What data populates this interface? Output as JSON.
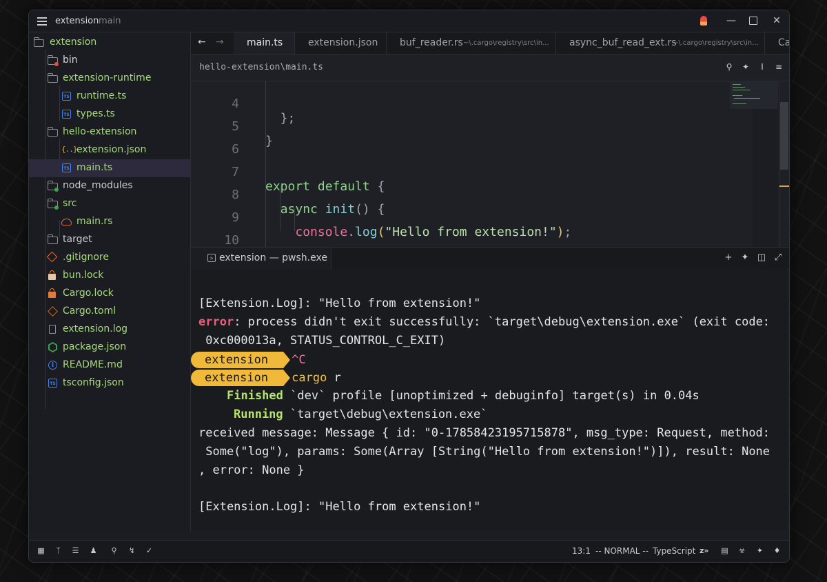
{
  "titlebar": {
    "project": "extension",
    "branch": "main"
  },
  "sidebar": {
    "items": [
      {
        "label": "extension",
        "icon": "folder-icon",
        "color": "#a6d97b"
      },
      {
        "label": "bin",
        "icon": "folder-icon",
        "color": "#d4d6dc"
      },
      {
        "label": "extension-runtime",
        "icon": "folder-icon",
        "color": "#a6d97b"
      },
      {
        "label": "runtime.ts",
        "icon": "typescript-icon",
        "color": "#a6d97b"
      },
      {
        "label": "types.ts",
        "icon": "typescript-icon",
        "color": "#a6d97b"
      },
      {
        "label": "hello-extension",
        "icon": "folder-icon",
        "color": "#a6d97b"
      },
      {
        "label": "extension.json",
        "icon": "json-icon",
        "color": "#a6d97b"
      },
      {
        "label": "main.ts",
        "icon": "typescript-icon",
        "color": "#a6d97b"
      },
      {
        "label": "node_modules",
        "icon": "folder-icon",
        "color": "#c8cbd2"
      },
      {
        "label": "src",
        "icon": "folder-icon",
        "color": "#a6d97b"
      },
      {
        "label": "main.rs",
        "icon": "rust-icon",
        "color": "#a6d97b"
      },
      {
        "label": "target",
        "icon": "folder-icon",
        "color": "#c8cbd2"
      },
      {
        "label": ".gitignore",
        "icon": "git-icon",
        "color": "#a6d97b"
      },
      {
        "label": "bun.lock",
        "icon": "lock-icon",
        "color": "#a6d97b"
      },
      {
        "label": "Cargo.lock",
        "icon": "lock-icon",
        "color": "#a6d97b"
      },
      {
        "label": "Cargo.toml",
        "icon": "cargo-icon",
        "color": "#a6d97b"
      },
      {
        "label": "extension.log",
        "icon": "file-icon",
        "color": "#a6d97b"
      },
      {
        "label": "package.json",
        "icon": "nodejs-icon",
        "color": "#a6d97b"
      },
      {
        "label": "README.md",
        "icon": "info-icon",
        "color": "#a6d97b"
      },
      {
        "label": "tsconfig.json",
        "icon": "tsconfig-icon",
        "color": "#a6d97b"
      }
    ]
  },
  "tabs": [
    {
      "title": "main.ts",
      "path": ""
    },
    {
      "title": "extension.json",
      "path": ""
    },
    {
      "title": "buf_reader.rs",
      "path": "~\\.cargo\\registry\\src\\in..."
    },
    {
      "title": "async_buf_read_ext.rs",
      "path": "~\\.cargo\\registry\\src\\in..."
    },
    {
      "title": "Ca",
      "path": ""
    }
  ],
  "breadcrumb": "hello-extension\\main.ts",
  "code": {
    "lines": [
      {
        "n": "4",
        "text": "  };"
      },
      {
        "n": "5",
        "text": "}"
      },
      {
        "n": "6",
        "text": ""
      },
      {
        "n": "7",
        "text": "export default {"
      },
      {
        "n": "8",
        "text": "  async init() {"
      },
      {
        "n": "9",
        "text": "    console.log(\"Hello from extension!\");"
      },
      {
        "n": "10",
        "text": "  },"
      }
    ]
  },
  "terminal": {
    "tab_title": "extension — pwsh.exe",
    "log1": "[Extension.Log]: \"Hello from extension!\"",
    "error_label": "error",
    "error_msg": ": process didn't exit successfully: `target\\debug\\extension.exe` (exit code:",
    "error_msg2": " 0xc000013a, STATUS_CONTROL_C_EXIT)",
    "prompt": "extension",
    "ctrl_c": "^C",
    "cmd": "cargo",
    "cmd_arg": " r",
    "finished_label": "Finished",
    "finished_msg": " `dev` profile [unoptimized + debuginfo] target(s) in 0.04s",
    "running_label": "Running",
    "running_msg": " `target\\debug\\extension.exe`",
    "recv1": "received message: Message { id: \"0-17858423195715878\", msg_type: Request, method:",
    "recv2": " Some(\"log\"), params: Some(Array [String(\"Hello from extension!\")]), result: None",
    "recv3": ", error: None }",
    "log2": "[Extension.Log]: \"Hello from extension!\""
  },
  "statusbar": {
    "position": "13:1",
    "mode": "-- NORMAL --",
    "language": "TypeScript"
  }
}
